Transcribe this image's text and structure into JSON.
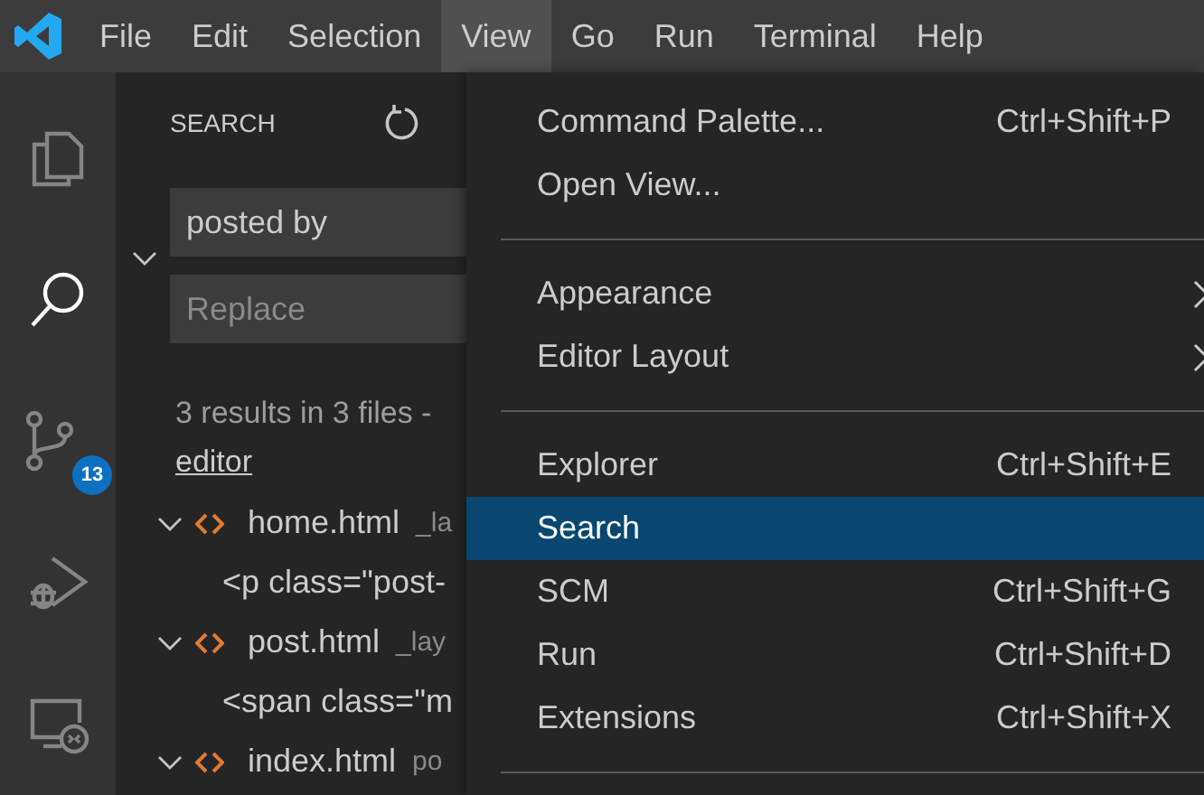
{
  "menu_bar": [
    {
      "label": "File",
      "selected": false
    },
    {
      "label": "Edit",
      "selected": false
    },
    {
      "label": "Selection",
      "selected": false
    },
    {
      "label": "View",
      "selected": true
    },
    {
      "label": "Go",
      "selected": false
    },
    {
      "label": "Run",
      "selected": false
    },
    {
      "label": "Terminal",
      "selected": false
    },
    {
      "label": "Help",
      "selected": false
    }
  ],
  "activity_bar": [
    {
      "kind": "files",
      "selected": false
    },
    {
      "kind": "search",
      "selected": true
    },
    {
      "kind": "source-control",
      "selected": false,
      "badge": "13"
    },
    {
      "kind": "run",
      "selected": false
    },
    {
      "kind": "remote",
      "selected": false
    }
  ],
  "sidebar": {
    "title": "SEARCH",
    "search": {
      "value": "posted by"
    },
    "replace": {
      "placeholder": "Replace"
    },
    "summary": "3 results in 3 files -",
    "summary_link": "editor",
    "results": [
      {
        "file": "home.html",
        "path": "_la",
        "expanded": true,
        "children": [
          {
            "text": "<p class=\"post-"
          }
        ]
      },
      {
        "file": "post.html",
        "path": "_lay",
        "expanded": true,
        "children": [
          {
            "text": "<span class=\"m"
          }
        ]
      },
      {
        "file": "index.html",
        "path": "po",
        "expanded": true
      }
    ]
  },
  "view_menu": {
    "items": [
      {
        "kind": "item",
        "label": "Command Palette...",
        "shortcut": "Ctrl+Shift+P",
        "selected": false
      },
      {
        "kind": "item",
        "label": "Open View...",
        "selected": false
      },
      {
        "kind": "separator"
      },
      {
        "kind": "submenu",
        "label": "Appearance",
        "selected": false
      },
      {
        "kind": "submenu",
        "label": "Editor Layout",
        "selected": false
      },
      {
        "kind": "separator"
      },
      {
        "kind": "item",
        "label": "Explorer",
        "shortcut": "Ctrl+Shift+E",
        "selected": false
      },
      {
        "kind": "item",
        "label": "Search",
        "selected": true
      },
      {
        "kind": "item",
        "label": "SCM",
        "shortcut": "Ctrl+Shift+G",
        "selected": false
      },
      {
        "kind": "item",
        "label": "Run",
        "shortcut": "Ctrl+Shift+D",
        "selected": false
      },
      {
        "kind": "item",
        "label": "Extensions",
        "shortcut": "Ctrl+Shift+X",
        "selected": false
      },
      {
        "kind": "separator"
      }
    ]
  }
}
